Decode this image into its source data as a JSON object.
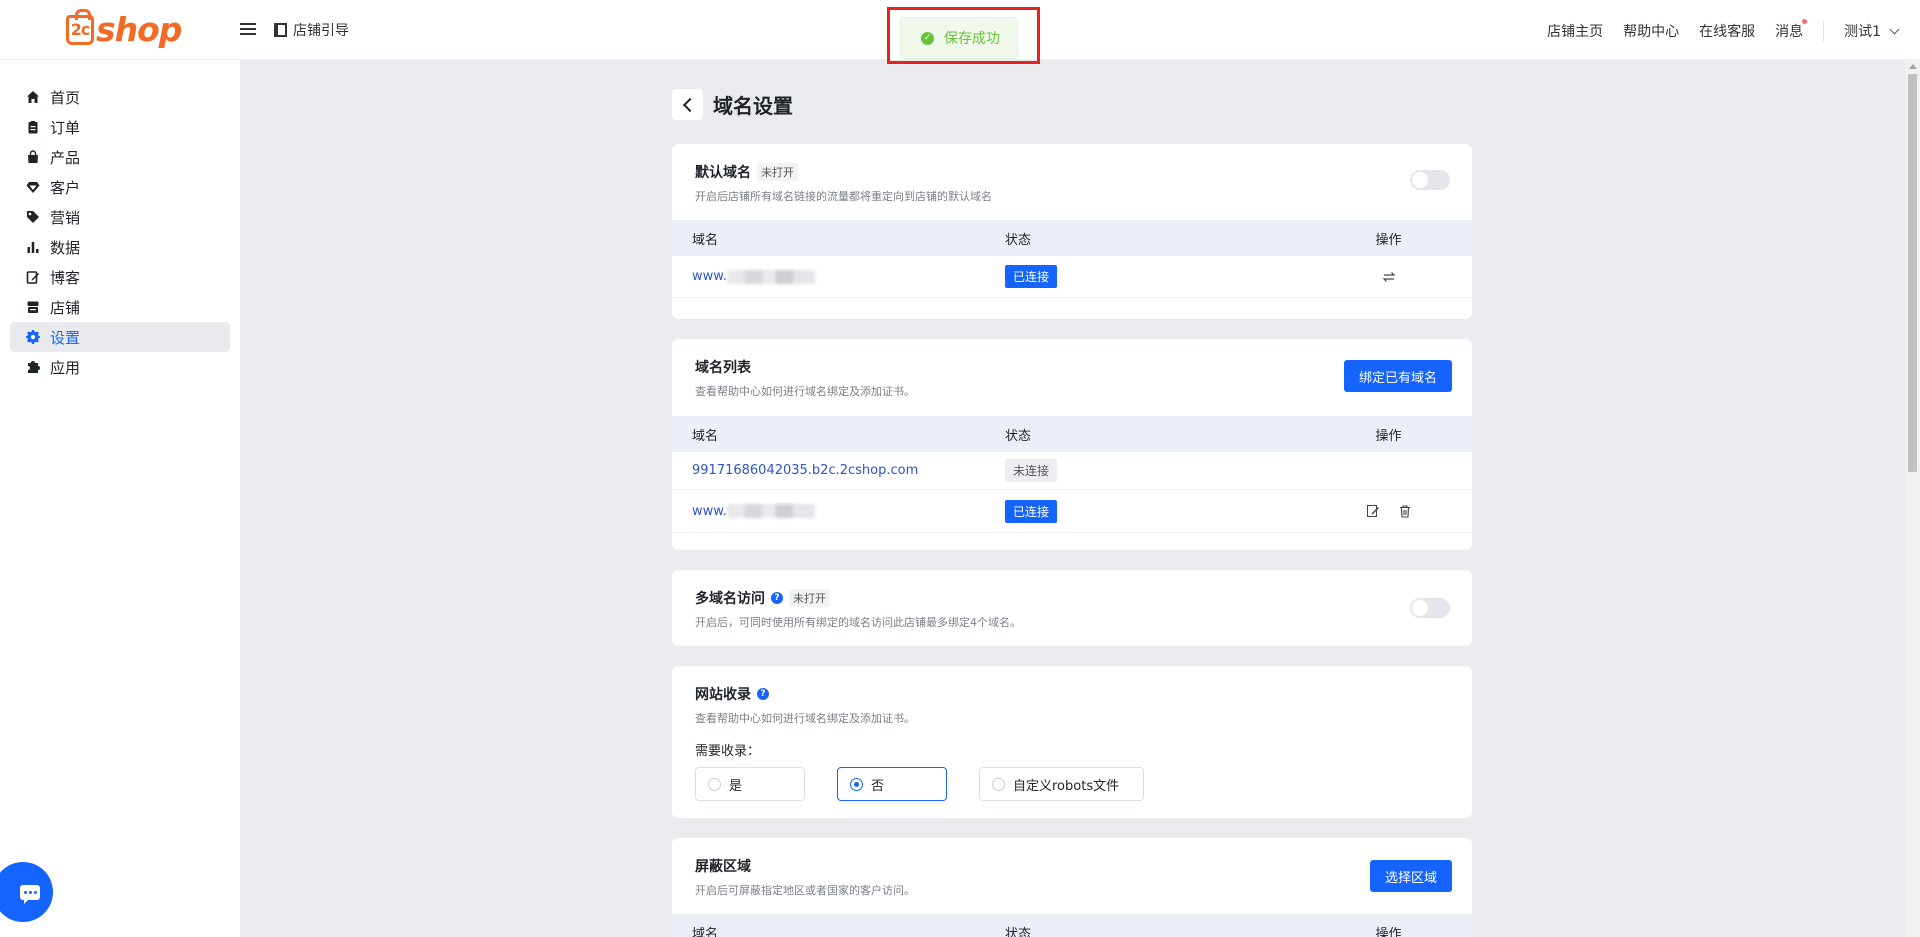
{
  "brand": {
    "logo_mark": "2c",
    "logo_text": "shop"
  },
  "topbar": {
    "guide_label": "店铺引导",
    "links": [
      "店铺主页",
      "帮助中心",
      "在线客服",
      "消息"
    ],
    "user": "测试1"
  },
  "toast": {
    "text": "保存成功",
    "color": "#67c23a"
  },
  "sidebar": {
    "items": [
      {
        "label": "首页",
        "icon": "home-icon"
      },
      {
        "label": "订单",
        "icon": "clipboard-icon"
      },
      {
        "label": "产品",
        "icon": "bag-icon"
      },
      {
        "label": "客户",
        "icon": "gem-icon"
      },
      {
        "label": "营销",
        "icon": "tag-icon"
      },
      {
        "label": "数据",
        "icon": "bar-chart-icon"
      },
      {
        "label": "博客",
        "icon": "edit-icon"
      },
      {
        "label": "店铺",
        "icon": "store-icon"
      },
      {
        "label": "设置",
        "icon": "gear-icon",
        "active": true
      },
      {
        "label": "应用",
        "icon": "puzzle-icon"
      }
    ]
  },
  "page": {
    "title": "域名设置"
  },
  "default_domain": {
    "title": "默认域名",
    "tag": "未打开",
    "desc": "开启后店铺所有域名链接的流量都将重定向到店铺的默认域名",
    "switch_on": false,
    "columns": [
      "域名",
      "状态",
      "操作"
    ],
    "rows": [
      {
        "domain_prefix": "www.",
        "status": "已连接"
      }
    ]
  },
  "domain_list": {
    "title": "域名列表",
    "desc": "查看帮助中心如何进行域名绑定及添加证书。",
    "button": "绑定已有域名",
    "columns": [
      "域名",
      "状态",
      "操作"
    ],
    "rows": [
      {
        "domain": "99171686042035.b2c.2cshop.com",
        "status": "未连接"
      },
      {
        "domain_prefix": "www.",
        "status": "已连接"
      }
    ]
  },
  "multi_domain": {
    "title": "多域名访问",
    "tag": "未打开",
    "desc": "开启后，可同时使用所有绑定的域名访问此店铺最多绑定4个域名。",
    "switch_on": false
  },
  "indexing": {
    "title": "网站收录",
    "desc": "查看帮助中心如何进行域名绑定及添加证书。",
    "label": "需要收录：",
    "options": [
      "是",
      "否",
      "自定义robots文件"
    ],
    "selected": "否"
  },
  "block_region": {
    "title": "屏蔽区域",
    "desc": "开启后可屏蔽指定地区或者国家的客户访问。",
    "button": "选择区域",
    "columns": [
      "域名",
      "状态",
      "操作"
    ]
  },
  "colors": {
    "accent": "#1664ff",
    "link": "#2c55c9",
    "brand": "#f26a24",
    "alert_outline": "#e8231f"
  }
}
